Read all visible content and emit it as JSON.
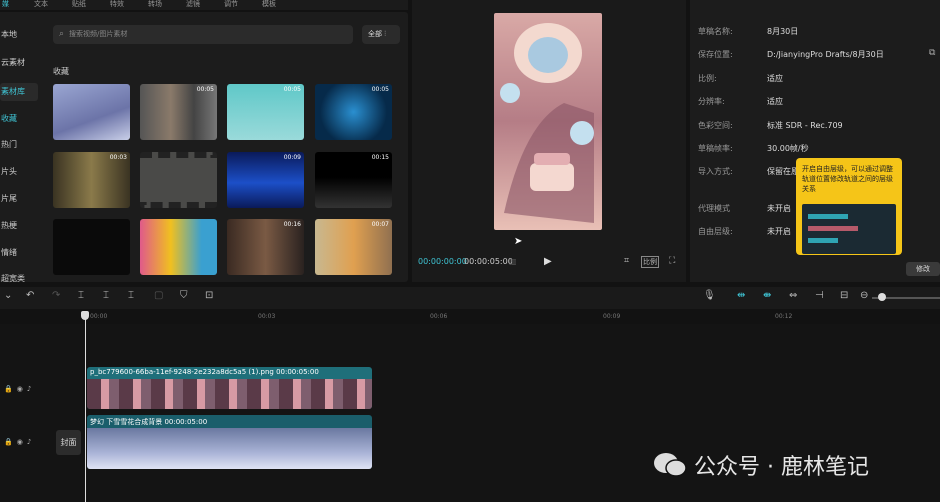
{
  "top_tabs": [
    "媒",
    "文本",
    "贴纸",
    "特效",
    "转场",
    "滤镜",
    "调节",
    "模板"
  ],
  "categories": [
    "本地",
    "云素材",
    "素材库",
    "收藏",
    "热门",
    "片头",
    "片尾",
    "热梗",
    "情绪",
    "超宽类"
  ],
  "search": {
    "placeholder": "搜索视频/图片素材"
  },
  "filter": {
    "label": "全部"
  },
  "favorites": {
    "title": "收藏"
  },
  "thumbs": [
    {
      "dur": ""
    },
    {
      "dur": "00:05"
    },
    {
      "dur": "00:05"
    },
    {
      "dur": "00:05"
    },
    {
      "dur": "00:03"
    },
    {
      "dur": ""
    },
    {
      "dur": "00:09"
    },
    {
      "dur": "00:15"
    },
    {
      "dur": ""
    },
    {
      "dur": ""
    },
    {
      "dur": "00:16"
    },
    {
      "dur": "00:07"
    }
  ],
  "preview": {
    "current": "00:00:00:00",
    "total": "00:00:05:00",
    "ratio": "比例"
  },
  "props": {
    "rows": [
      {
        "label": "草稿名称:",
        "value": "8月30日"
      },
      {
        "label": "保存位置:",
        "value": "D:/JianyingPro Drafts/8月30日"
      },
      {
        "label": "比例:",
        "value": "适应"
      },
      {
        "label": "分辨率:",
        "value": "适应"
      },
      {
        "label": "色彩空间:",
        "value": "标准 SDR - Rec.709"
      },
      {
        "label": "草稿帧率:",
        "value": "30.00帧/秒"
      },
      {
        "label": "导入方式:",
        "value": "保留在原"
      },
      {
        "label": "代理模式",
        "value": "未开启"
      },
      {
        "label": "自由层级:",
        "value": "未开启"
      }
    ],
    "edit_button": "修改"
  },
  "tooltip": {
    "text": "开启自由层级，可以通过调整轨道位置修改轨道之间的层级关系"
  },
  "ruler": [
    "00:00",
    "00:03",
    "00:06",
    "00:09",
    "00:12"
  ],
  "cover": "封面",
  "clips": {
    "video": "p_bc779600-66ba-11ef-9248-2e232a8dc5a5 (1).png  00:00:05:00",
    "effect": "梦幻 下雪雪花合成背景  00:00:05:00"
  },
  "watermark": "公众号 · 鹿林笔记",
  "colors": {
    "accent": "#3fc3d3",
    "tooltip": "#f5c518",
    "clip": "#1f6f7a"
  }
}
